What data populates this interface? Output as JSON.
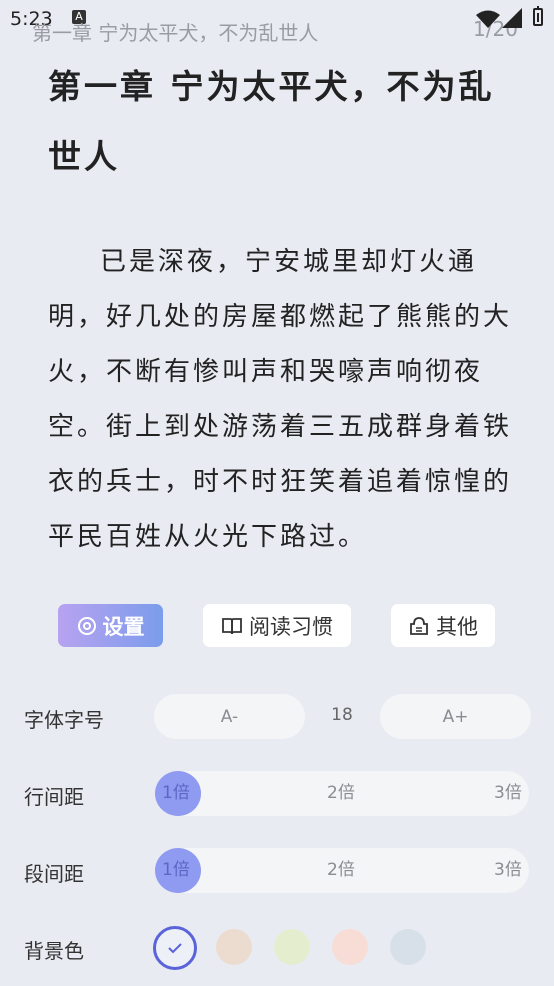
{
  "status_bar": {
    "time": "5:23",
    "notification_badge": "A",
    "running_title": "第一章 宁为太平犬，不为乱世人",
    "page_indicator": "1/20"
  },
  "chapter": {
    "title": "第一章 宁为太平犬，不为乱世人",
    "paragraph": "已是深夜，宁安城里却灯火通明，好几处的房屋都燃起了熊熊的大火，不断有惨叫声和哭嚎声响彻夜空。街上到处游荡着三五成群身着铁衣的兵士，时不时狂笑着追着惊惶的平民百姓从火光下路过。"
  },
  "tabs": [
    {
      "label": "设置",
      "icon": "gear-icon",
      "selected": true
    },
    {
      "label": "阅读习惯",
      "icon": "book-icon",
      "selected": false
    },
    {
      "label": "其他",
      "icon": "other-icon",
      "selected": false
    }
  ],
  "settings": {
    "font_size": {
      "label": "字体字号",
      "decrease": "A-",
      "value": "18",
      "increase": "A+"
    },
    "line_spacing": {
      "label": "行间距",
      "options": [
        "1倍",
        "2倍",
        "3倍"
      ],
      "selected": "1倍"
    },
    "paragraph_spacing": {
      "label": "段间距",
      "options": [
        "1倍",
        "2倍",
        "3倍"
      ],
      "selected": "1倍"
    },
    "background": {
      "label": "背景色",
      "swatches": [
        "#eef0f7",
        "#ecdccf",
        "#e4eece",
        "#f8dcd6",
        "#d7dfe8"
      ],
      "selected_index": 0
    }
  },
  "colors": {
    "accent": "#5a64d8",
    "tab_gradient_start": "#b7a3f0",
    "tab_gradient_end": "#7b9cec",
    "page_background": "#e9ebf3"
  }
}
